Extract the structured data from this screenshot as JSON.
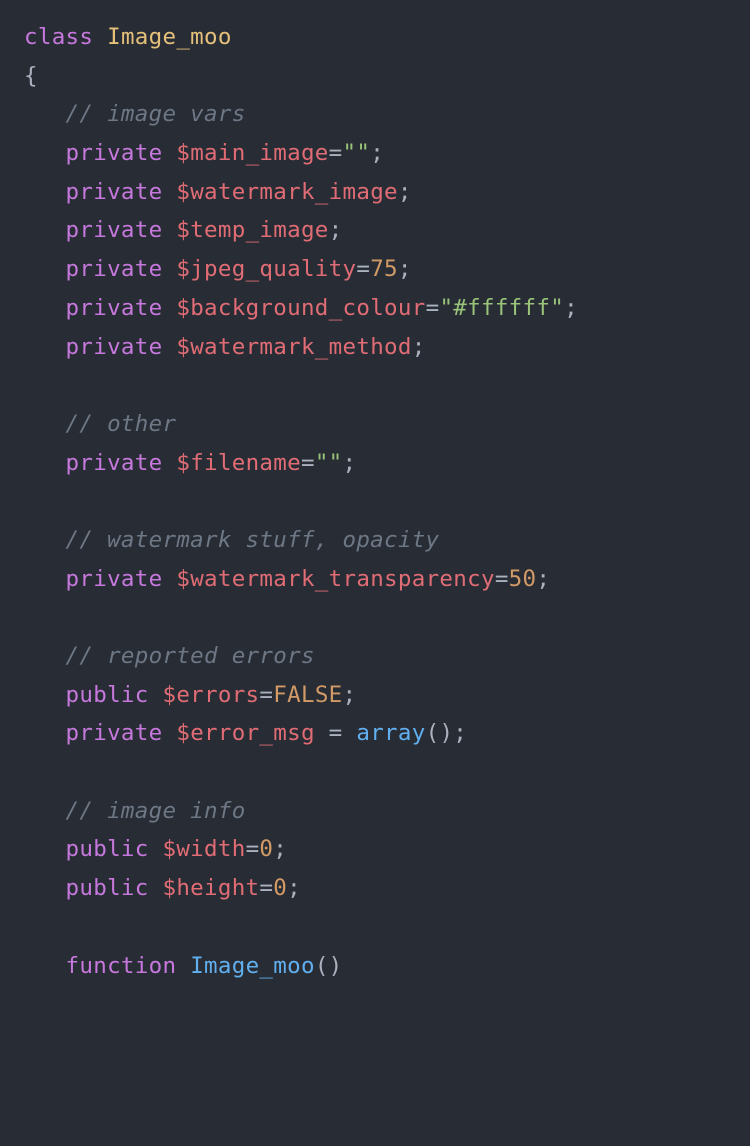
{
  "code": {
    "line1": {
      "keyword": "class",
      "className": "Image_moo"
    },
    "line2": {
      "brace": "{"
    },
    "line3": {
      "comment": "// image vars"
    },
    "line4": {
      "keyword": "private",
      "variable": "$main_image",
      "operator": "=",
      "string": "\"\"",
      "semicolon": ";"
    },
    "line5": {
      "keyword": "private",
      "variable": "$watermark_image",
      "semicolon": ";"
    },
    "line6": {
      "keyword": "private",
      "variable": "$temp_image",
      "semicolon": ";"
    },
    "line7": {
      "keyword": "private",
      "variable": "$jpeg_quality",
      "operator": "=",
      "number": "75",
      "semicolon": ";"
    },
    "line8": {
      "keyword": "private",
      "variable": "$background_colour",
      "operator": "=",
      "string": "\"#ffffff\"",
      "semicolon": ";"
    },
    "line9": {
      "keyword": "private",
      "variable": "$watermark_method",
      "semicolon": ";"
    },
    "line10": {
      "comment": "// other"
    },
    "line11": {
      "keyword": "private",
      "variable": "$filename",
      "operator": "=",
      "string": "\"\"",
      "semicolon": ";"
    },
    "line12": {
      "comment": "// watermark stuff, opacity"
    },
    "line13": {
      "keyword": "private",
      "variable": "$watermark_transparency",
      "operator": "=",
      "number": "50",
      "semicolon": ";"
    },
    "line14": {
      "comment": "// reported errors"
    },
    "line15": {
      "keyword": "public",
      "variable": "$errors",
      "operator": "=",
      "constant": "FALSE",
      "semicolon": ";"
    },
    "line16": {
      "keyword": "private",
      "variable": "$error_msg",
      "operator": " = ",
      "function": "array",
      "parens": "()",
      "semicolon": ";"
    },
    "line17": {
      "comment": "// image info"
    },
    "line18": {
      "keyword": "public",
      "variable": "$width",
      "operator": "=",
      "number": "0",
      "semicolon": ";"
    },
    "line19": {
      "keyword": "public",
      "variable": "$height",
      "operator": "=",
      "number": "0",
      "semicolon": ";"
    },
    "line20": {
      "keyword": "function",
      "functionName": "Image_moo",
      "parens": "()"
    }
  }
}
